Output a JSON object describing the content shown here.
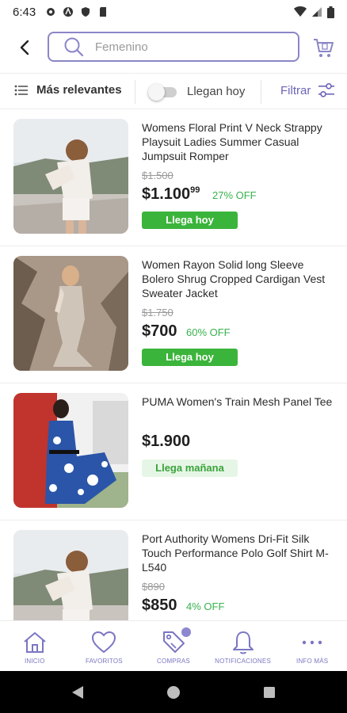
{
  "status": {
    "time": "6:43"
  },
  "search": {
    "placeholder": "Femenino"
  },
  "filters": {
    "sort_label": "Más relevantes",
    "toggle_label": "Llegan hoy",
    "filter_label": "Filtrar"
  },
  "colors": {
    "accent": "#6b64b8",
    "green": "#3bb43b",
    "light_green": "#e6f6e6",
    "off_green": "#37b24d"
  },
  "products": [
    {
      "title": "Womens Floral Print V Neck Strappy Playsuit Ladies Summer Casual Jumpsuit Romper",
      "old_price": "$1.500",
      "price": "$1.100",
      "price_cents": "99",
      "off": "27% OFF",
      "badge": "Llega hoy"
    },
    {
      "title": "Women Rayon Solid long Sleeve Bolero Shrug Cropped Cardigan Vest Sweater Jacket",
      "old_price": "$1.750",
      "price": "$700",
      "off": "60% OFF",
      "badge": "Llega hoy"
    },
    {
      "title": "PUMA Women's Train Mesh Panel Tee",
      "price": "$1.900",
      "badge": "Llega mañana"
    },
    {
      "title": "Port Authority Womens Dri-Fit Silk Touch Performance Polo Golf Shirt M-L540",
      "old_price": "$890",
      "price": "$850",
      "off": "4% OFF"
    }
  ],
  "nav": [
    {
      "label": "INICIO",
      "icon": "home-icon"
    },
    {
      "label": "FAVORITOS",
      "icon": "heart-icon"
    },
    {
      "label": "COMPRAS",
      "icon": "tag-icon"
    },
    {
      "label": "NOTIFICACIONES",
      "icon": "bell-icon"
    },
    {
      "label": "INFO MÁS",
      "icon": "more-icon"
    }
  ]
}
